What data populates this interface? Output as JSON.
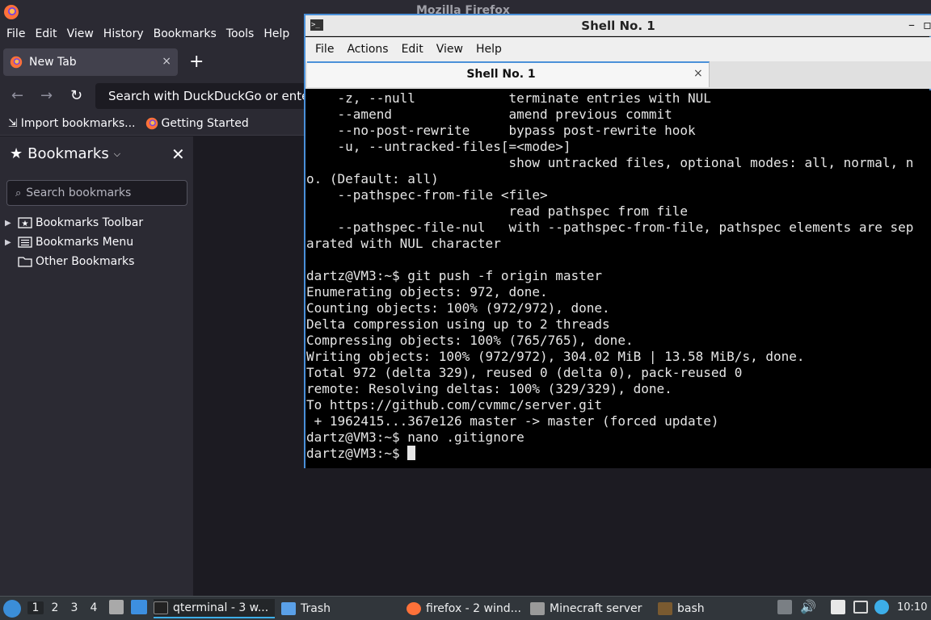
{
  "firefox": {
    "window_title": "Mozilla Firefox",
    "menu": [
      "File",
      "Edit",
      "View",
      "History",
      "Bookmarks",
      "Tools",
      "Help"
    ],
    "tab": {
      "label": "New Tab",
      "close": "×"
    },
    "new_tab_symbol": "+",
    "urlbar": {
      "placeholder": "Search with DuckDuckGo or enter address"
    },
    "bookmarks_toolbar": [
      {
        "label": "Import bookmarks...",
        "icon": "import-icon"
      },
      {
        "label": "Getting Started",
        "icon": "firefox-icon"
      }
    ],
    "sidebar": {
      "title": "Bookmarks",
      "search_placeholder": "Search bookmarks",
      "items": [
        {
          "label": "Bookmarks Toolbar",
          "icon": "bookmarks-toolbar-icon",
          "expandable": true
        },
        {
          "label": "Bookmarks Menu",
          "icon": "bookmarks-menu-icon",
          "expandable": true
        },
        {
          "label": "Other Bookmarks",
          "icon": "folder-icon",
          "expandable": false
        }
      ]
    }
  },
  "terminal": {
    "window_title": "Shell No. 1",
    "menu": [
      "File",
      "Actions",
      "Edit",
      "View",
      "Help"
    ],
    "tab": {
      "label": "Shell No. 1",
      "close": "×"
    },
    "lines": [
      "    -z, --null            terminate entries with NUL",
      "    --amend               amend previous commit",
      "    --no-post-rewrite     bypass post-rewrite hook",
      "    -u, --untracked-files[=<mode>]",
      "                          show untracked files, optional modes: all, normal, n",
      "o. (Default: all)",
      "    --pathspec-from-file <file>",
      "                          read pathspec from file",
      "    --pathspec-file-nul   with --pathspec-from-file, pathspec elements are sep",
      "arated with NUL character",
      "",
      "dartz@VM3:~$ git push -f origin master",
      "Enumerating objects: 972, done.",
      "Counting objects: 100% (972/972), done.",
      "Delta compression using up to 2 threads",
      "Compressing objects: 100% (765/765), done.",
      "Writing objects: 100% (972/972), 304.02 MiB | 13.58 MiB/s, done.",
      "Total 972 (delta 329), reused 0 (delta 0), pack-reused 0",
      "remote: Resolving deltas: 100% (329/329), done.",
      "To https://github.com/cvmmc/server.git",
      " + 1962415...367e126 master -> master (forced update)",
      "dartz@VM3:~$ nano .gitignore"
    ],
    "prompt": "dartz@VM3:~$ "
  },
  "taskbar": {
    "workspaces": [
      "1",
      "2",
      "3",
      "4"
    ],
    "active_workspace": "1",
    "tasks": [
      {
        "label": "qterminal - 3 w...",
        "icon": "terminal-icon",
        "active": true
      },
      {
        "label": "Trash",
        "icon": "trash-folder-icon",
        "active": false
      },
      {
        "label": "firefox - 2 wind...",
        "icon": "firefox-icon",
        "active": false
      },
      {
        "label": "Minecraft server",
        "icon": "minecraft-icon",
        "active": false
      },
      {
        "label": "bash",
        "icon": "bash-icon",
        "active": false
      }
    ],
    "clock": "10:10"
  },
  "colors": {
    "firefox_bg": "#2b2a33",
    "terminal_border": "#4a90d9",
    "taskbar_bg": "#31363b"
  }
}
